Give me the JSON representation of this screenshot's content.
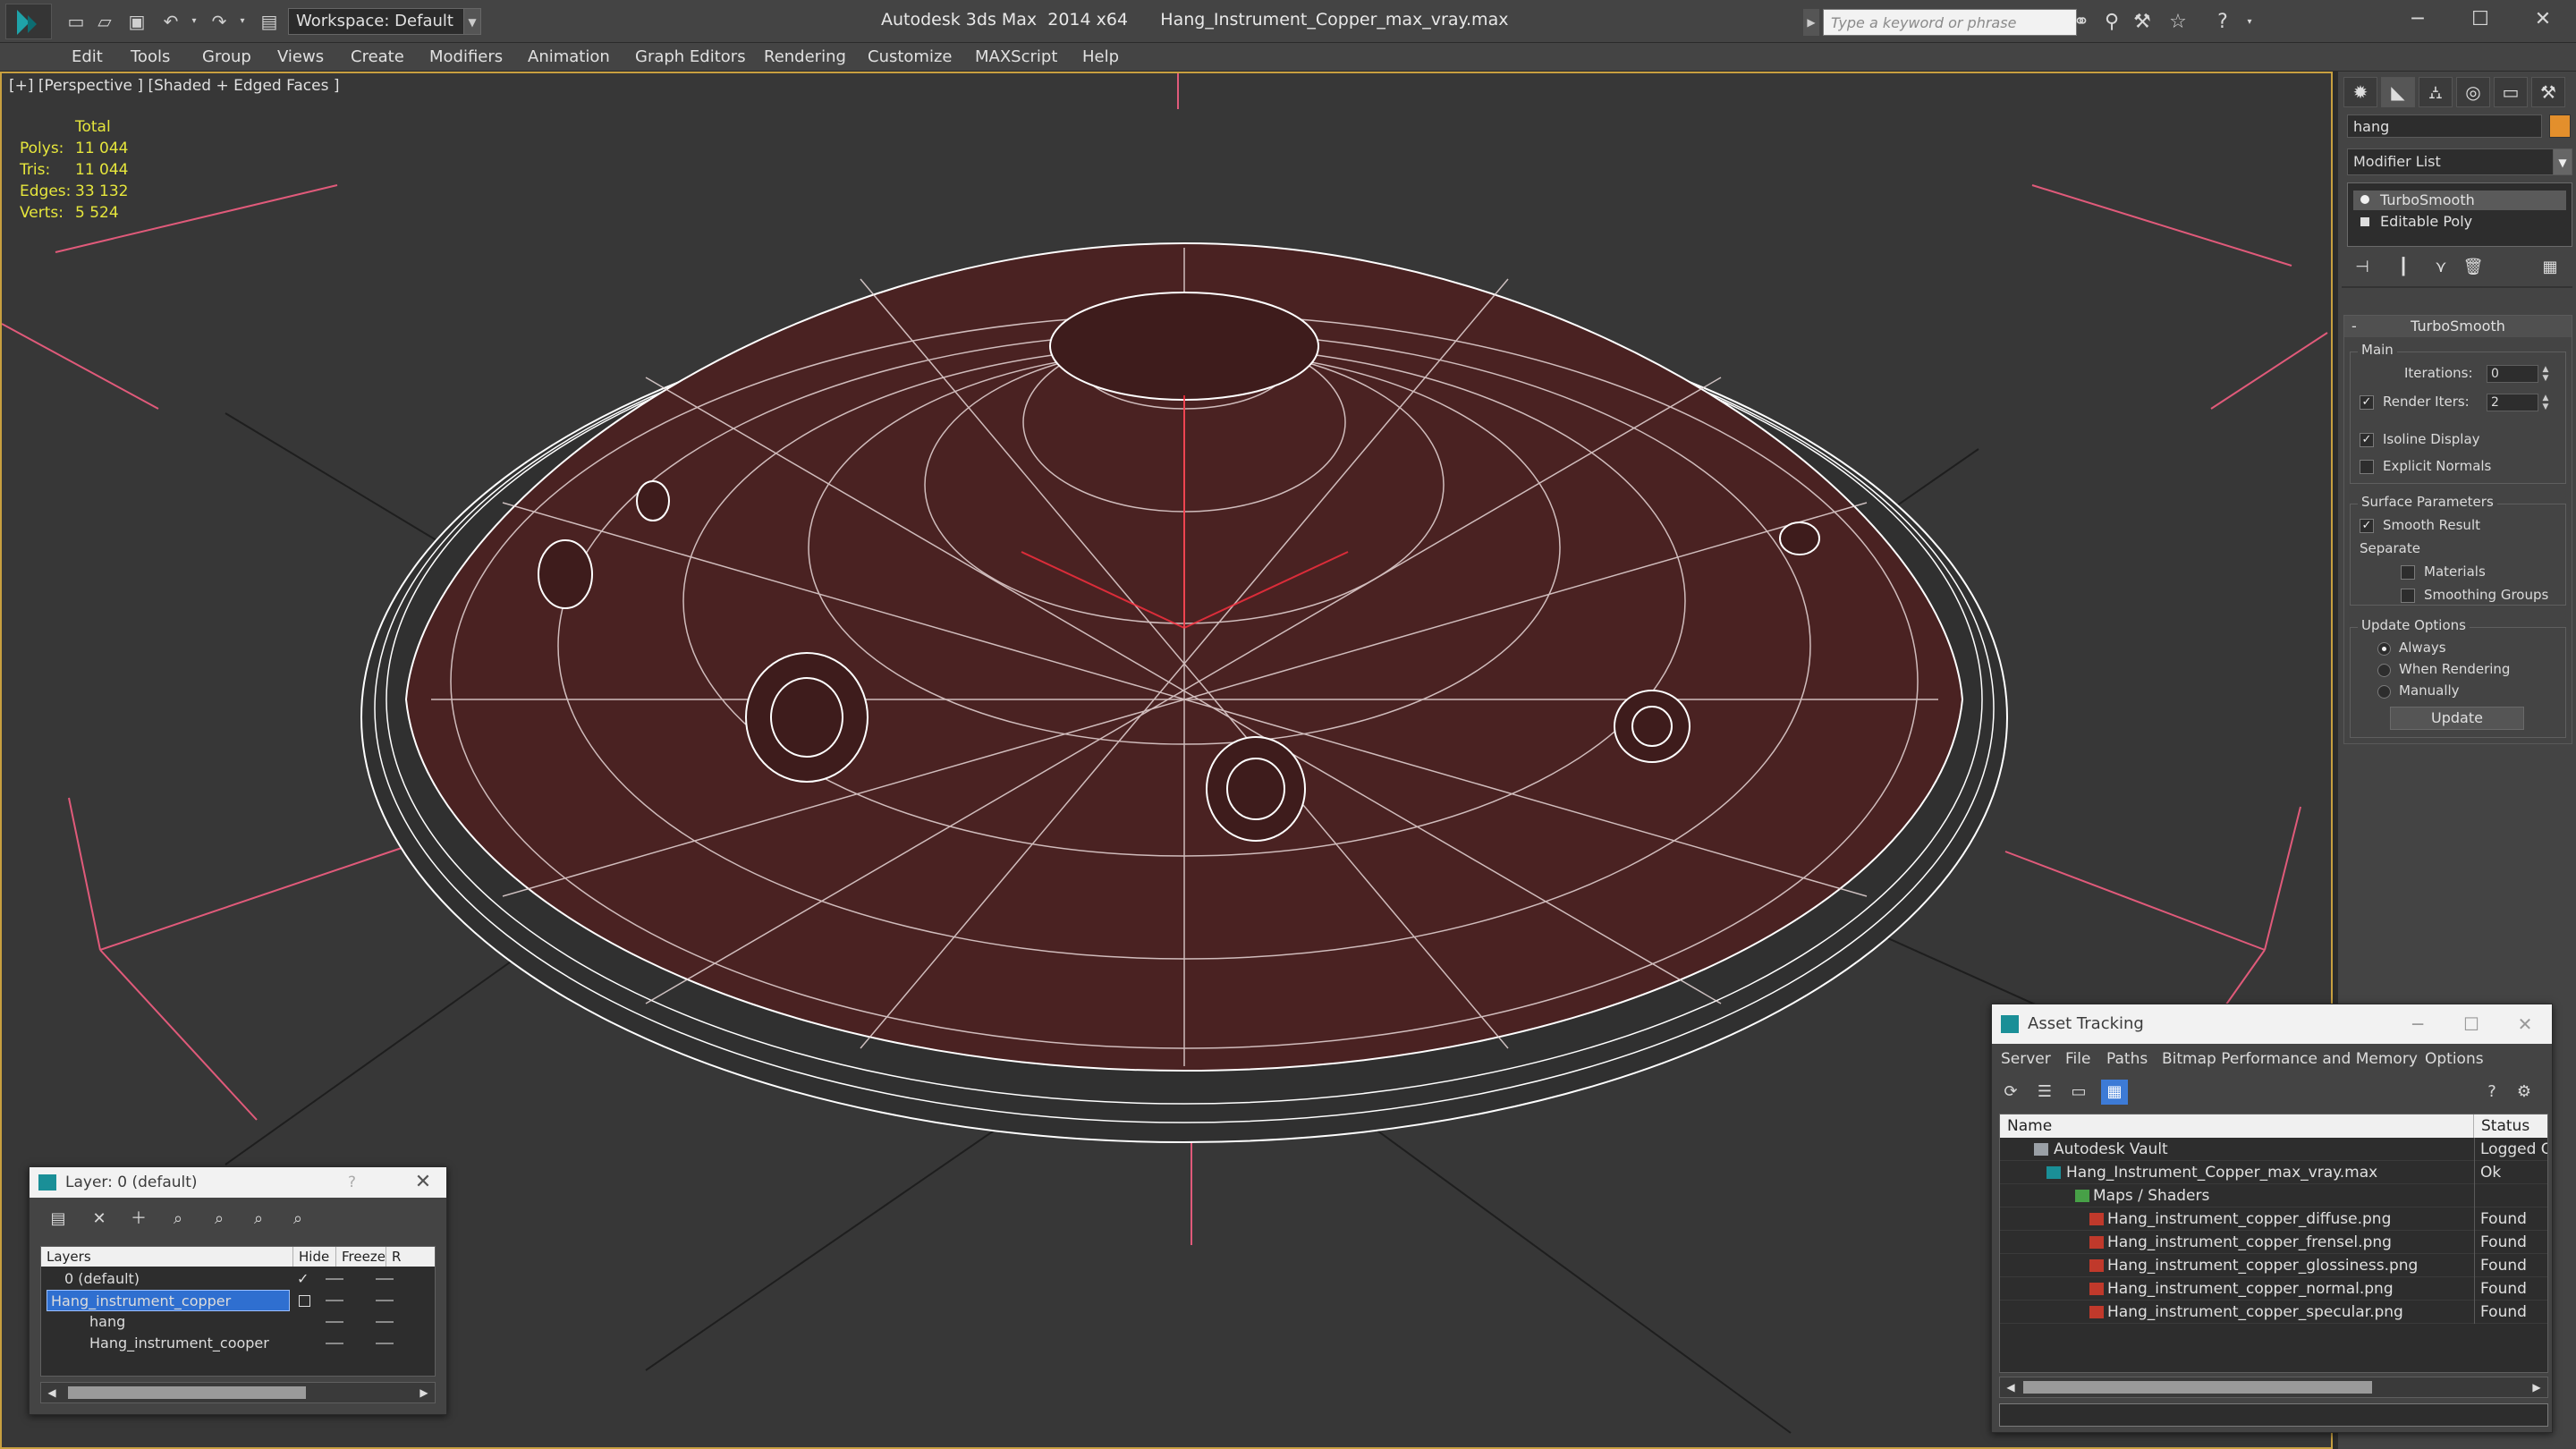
{
  "titlebar": {
    "workspace": "Workspace: Default",
    "window_title": "Autodesk 3ds Max  2014 x64      Hang_Instrument_Copper_max_vray.max",
    "search_placeholder": "Type a keyword or phrase"
  },
  "menu": [
    "Edit",
    "Tools",
    "Group",
    "Views",
    "Create",
    "Modifiers",
    "Animation",
    "Graph Editors",
    "Rendering",
    "Customize",
    "MAXScript",
    "Help"
  ],
  "viewport": {
    "label": "[+] [Perspective ] [Shaded + Edged Faces ]",
    "stats_header": "Total",
    "stats": [
      {
        "label": "Polys:",
        "value": "11 044"
      },
      {
        "label": "Tris:",
        "value": "11 044"
      },
      {
        "label": "Edges:",
        "value": "33 132"
      },
      {
        "label": "Verts:",
        "value": "5 524"
      }
    ],
    "colors": {
      "background": "#373737",
      "mesh": "#4a2222",
      "wire": "#ffffff",
      "grid": "#1e1e1e",
      "light": "#e05a7a",
      "border": "#c8a040"
    }
  },
  "command_panel": {
    "object_name": "hang",
    "object_color": "#e38f2c",
    "modifier_list": "Modifier List",
    "stack": [
      "TurboSmooth",
      "Editable Poly"
    ],
    "rollout_title": "TurboSmooth",
    "rollout_collapse": "-",
    "main_group": "Main",
    "iterations_label": "Iterations:",
    "iterations_value": "0",
    "render_iters_label": "Render Iters:",
    "render_iters_value": "2",
    "isoline_display": "Isoline Display",
    "explicit_normals": "Explicit Normals",
    "surface_group": "Surface Parameters",
    "smooth_result": "Smooth Result",
    "separate": "Separate",
    "materials": "Materials",
    "smoothing_groups": "Smoothing Groups",
    "update_group": "Update Options",
    "always": "Always",
    "when_rendering": "When Rendering",
    "manually": "Manually",
    "update_button": "Update"
  },
  "layer_dialog": {
    "title": "Layer: 0 (default)",
    "help": "?",
    "columns": [
      "Layers",
      "Hide",
      "Freeze",
      "R"
    ],
    "rows": [
      "0 (default)",
      "Hang_instrument_copper",
      "hang",
      "Hang_instrument_cooper"
    ]
  },
  "asset_tracking": {
    "title": "Asset Tracking",
    "menu": [
      "Server",
      "File",
      "Paths",
      "Bitmap Performance and Memory",
      "Options"
    ],
    "columns": [
      "Name",
      "Status"
    ],
    "rows": [
      {
        "name": "Autodesk Vault",
        "status": "Logged O"
      },
      {
        "name": "Hang_Instrument_Copper_max_vray.max",
        "status": "Ok"
      },
      {
        "name": "Maps / Shaders",
        "status": ""
      },
      {
        "name": "Hang_instrument_copper_diffuse.png",
        "status": "Found"
      },
      {
        "name": "Hang_instrument_copper_frensel.png",
        "status": "Found"
      },
      {
        "name": "Hang_instrument_copper_glossiness.png",
        "status": "Found"
      },
      {
        "name": "Hang_instrument_copper_normal.png",
        "status": "Found"
      },
      {
        "name": "Hang_instrument_copper_specular.png",
        "status": "Found"
      }
    ]
  }
}
